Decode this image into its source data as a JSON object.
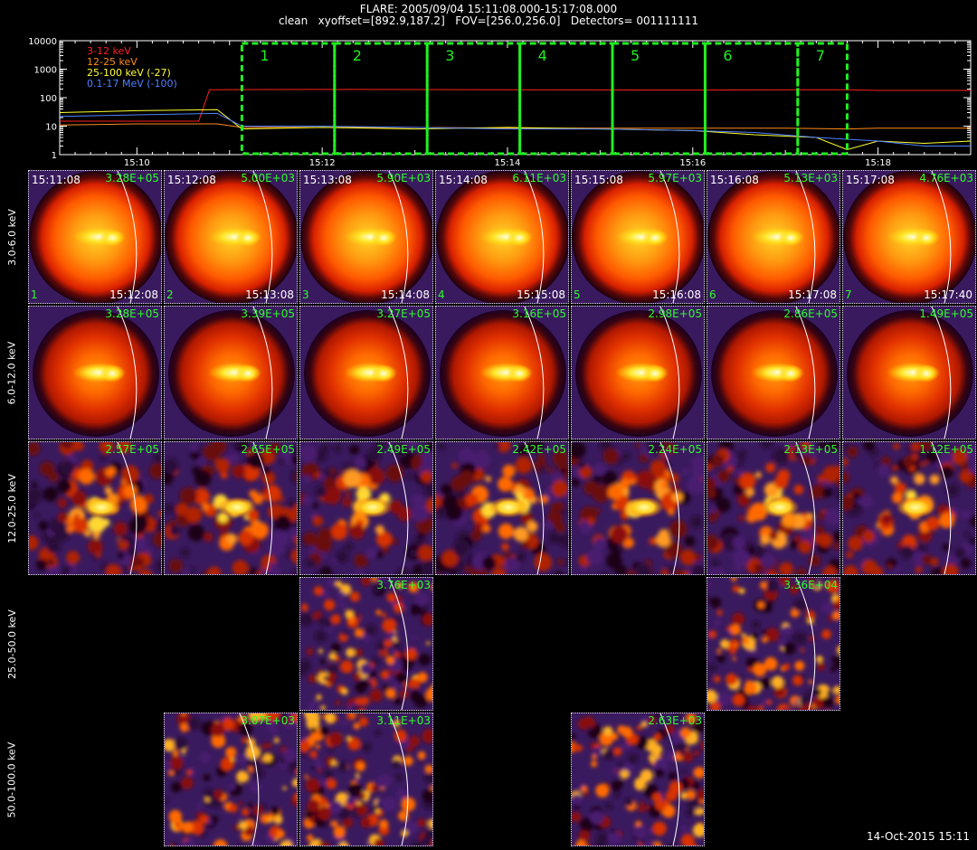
{
  "header": {
    "line1": "FLARE: 2005/09/04 15:11:08.000-15:17:08.000",
    "line2": "clean   xyoffset=[892.9,187.2]   FOV=[256.0,256.0]   Detectors= 001111111"
  },
  "chart_data": [
    {
      "type": "line",
      "scale": "log",
      "y_ticks": [
        "10000",
        "1000",
        "100",
        "10",
        "1"
      ],
      "ylim": [
        1,
        10000
      ],
      "x_ticks": [
        "15:10",
        "15:12",
        "15:14",
        "15:16",
        "15:18"
      ],
      "xlim": [
        "15:09:10",
        "15:19:00"
      ],
      "series": [
        {
          "name": "3-12 keV",
          "color": "#ff2020",
          "x": [
            "15:09:10",
            "15:10:40",
            "15:10:47",
            "15:12:00",
            "15:14:00",
            "15:16:00",
            "15:17:40",
            "15:18:00",
            "15:19:00"
          ],
          "values": [
            15,
            15,
            190,
            195,
            190,
            185,
            190,
            180,
            180
          ]
        },
        {
          "name": "12-25 keV",
          "color": "#ff8c1a",
          "x": [
            "15:09:10",
            "15:10:00",
            "15:10:52",
            "15:11:08",
            "15:12:00",
            "15:13:00",
            "15:14:00",
            "15:15:00",
            "15:16:00",
            "15:17:00",
            "15:17:40",
            "15:18:00",
            "15:19:00"
          ],
          "values": [
            11,
            12,
            12,
            9,
            9,
            9,
            8.5,
            8.5,
            8.5,
            8.5,
            8,
            8.5,
            8.5
          ]
        },
        {
          "name": "25-100 keV (-27)",
          "color": "#ffff30",
          "x": [
            "15:09:10",
            "15:10:00",
            "15:10:52",
            "15:11:08",
            "15:12:00",
            "15:13:00",
            "15:14:00",
            "15:15:00",
            "15:16:00",
            "15:16:40",
            "15:17:20",
            "15:17:40",
            "15:18:00",
            "15:18:30",
            "15:19:00"
          ],
          "values": [
            30,
            35,
            38,
            8,
            9,
            8,
            9,
            8,
            7,
            5,
            4,
            1.5,
            3,
            2.5,
            3
          ]
        },
        {
          "name": "0.1-17 MeV (-100)",
          "color": "#5080ff",
          "x": [
            "15:09:10",
            "15:10:00",
            "15:10:52",
            "15:11:08",
            "15:12:00",
            "15:13:00",
            "15:14:00",
            "15:15:00",
            "15:16:00",
            "15:16:40",
            "15:17:20",
            "15:18:00",
            "15:18:30",
            "15:19:00"
          ],
          "values": [
            22,
            25,
            28,
            10,
            10,
            9,
            8,
            8,
            7,
            6,
            4,
            3,
            2,
            2
          ]
        }
      ],
      "intervals": [
        {
          "label": "1",
          "start": "15:11:08",
          "end": "15:12:08"
        },
        {
          "label": "2",
          "start": "15:12:08",
          "end": "15:13:08"
        },
        {
          "label": "3",
          "start": "15:13:08",
          "end": "15:14:08"
        },
        {
          "label": "4",
          "start": "15:14:08",
          "end": "15:15:08"
        },
        {
          "label": "5",
          "start": "15:15:08",
          "end": "15:16:08"
        },
        {
          "label": "6",
          "start": "15:16:08",
          "end": "15:17:08"
        },
        {
          "label": "7",
          "start": "15:17:08",
          "end": "15:17:40"
        }
      ],
      "interval_color": "#22ee22"
    },
    {
      "type": "heatmap",
      "rows": [
        {
          "label": "3.0-6.0 keV",
          "style": "disk-sharp",
          "cells": [
            {
              "col": 1,
              "start": "15:11:08",
              "max": "3.28E+05",
              "idx": "1",
              "end": "15:12:08"
            },
            {
              "col": 2,
              "start": "15:12:08",
              "max": "5.00E+03",
              "idx": "2",
              "end": "15:13:08"
            },
            {
              "col": 3,
              "start": "15:13:08",
              "max": "5.90E+03",
              "idx": "3",
              "end": "15:14:08"
            },
            {
              "col": 4,
              "start": "15:14:08",
              "max": "6.11E+03",
              "idx": "4",
              "end": "15:15:08"
            },
            {
              "col": 5,
              "start": "15:15:08",
              "max": "5.97E+03",
              "idx": "5",
              "end": "15:16:08"
            },
            {
              "col": 6,
              "start": "15:16:08",
              "max": "5.13E+03",
              "idx": "6",
              "end": "15:17:08"
            },
            {
              "col": 7,
              "start": "15:17:08",
              "max": "4.76E+03",
              "idx": "7",
              "end": "15:17:40"
            }
          ]
        },
        {
          "label": "6.0-12.0 keV",
          "style": "disk-soft",
          "cells": [
            {
              "col": 1,
              "max": "3.28E+05"
            },
            {
              "col": 2,
              "max": "3.39E+05"
            },
            {
              "col": 3,
              "max": "3.27E+05"
            },
            {
              "col": 4,
              "max": "3.16E+05"
            },
            {
              "col": 5,
              "max": "2.98E+05"
            },
            {
              "col": 6,
              "max": "2.86E+05"
            },
            {
              "col": 7,
              "max": "1.49E+05"
            }
          ]
        },
        {
          "label": "12.0-25.0 keV",
          "style": "blob",
          "cells": [
            {
              "col": 1,
              "max": "2.57E+05"
            },
            {
              "col": 2,
              "max": "2.65E+05"
            },
            {
              "col": 3,
              "max": "2.49E+05"
            },
            {
              "col": 4,
              "max": "2.42E+05"
            },
            {
              "col": 5,
              "max": "2.24E+05"
            },
            {
              "col": 6,
              "max": "2.13E+05"
            },
            {
              "col": 7,
              "max": "1.12E+05"
            }
          ]
        },
        {
          "label": "25.0-50.0 keV",
          "style": "noise",
          "cells": [
            {
              "col": 3,
              "max": "3.76E+03"
            },
            {
              "col": 6,
              "max": "3.36E+04"
            }
          ]
        },
        {
          "label": "50.0-100.0 keV",
          "style": "noise",
          "cells": [
            {
              "col": 2,
              "max": "3.07E+03"
            },
            {
              "col": 3,
              "max": "3.11E+03"
            },
            {
              "col": 5,
              "max": "2.63E+03"
            }
          ]
        }
      ]
    }
  ],
  "footer": {
    "timestamp": "14-Oct-2015 15:11"
  }
}
